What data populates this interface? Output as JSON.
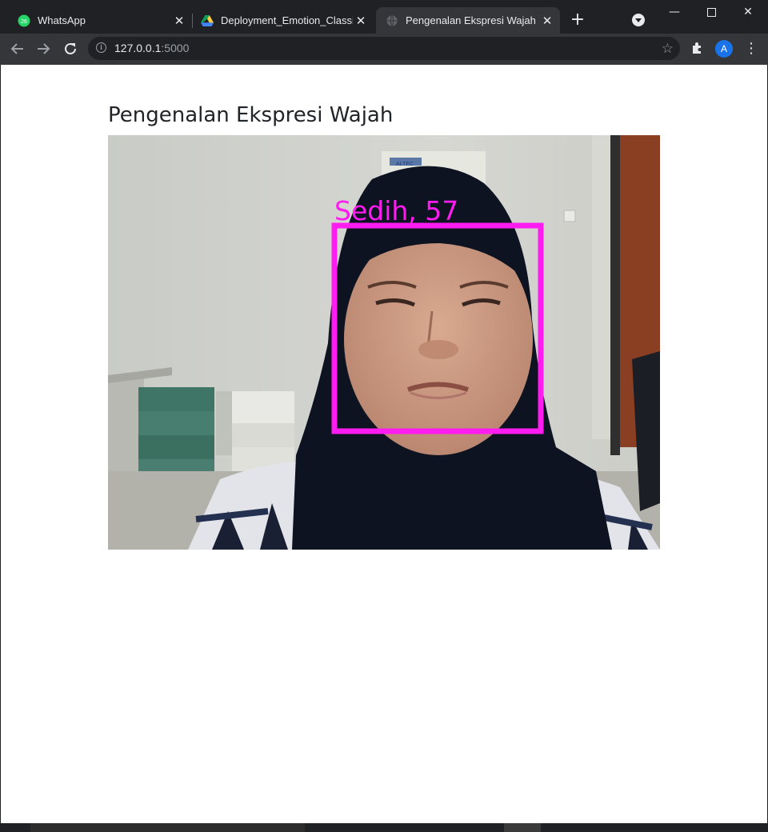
{
  "browser": {
    "tabs": [
      {
        "title": "WhatsApp",
        "badge": "26",
        "icon": "whatsapp-icon",
        "active": false
      },
      {
        "title": "Deployment_Emotion_Classification",
        "icon": "google-drive-icon",
        "active": false
      },
      {
        "title": "Pengenalan Ekspresi Wajah",
        "icon": "globe-icon",
        "active": true
      }
    ],
    "address": {
      "host": "127.0.0.1",
      "port": ":5000"
    },
    "profile_initial": "A"
  },
  "page": {
    "title": "Pengenalan Ekspresi Wajah",
    "stream": {
      "detection_label": "Sedih, 57",
      "box_color": "#ff1cf0"
    },
    "poster_text": "ALTEC"
  },
  "colors": {
    "chrome_dark": "#202124",
    "chrome_toolbar": "#35363a",
    "profile_blue": "#1a73e8",
    "detection_magenta": "#ff1cf0"
  }
}
